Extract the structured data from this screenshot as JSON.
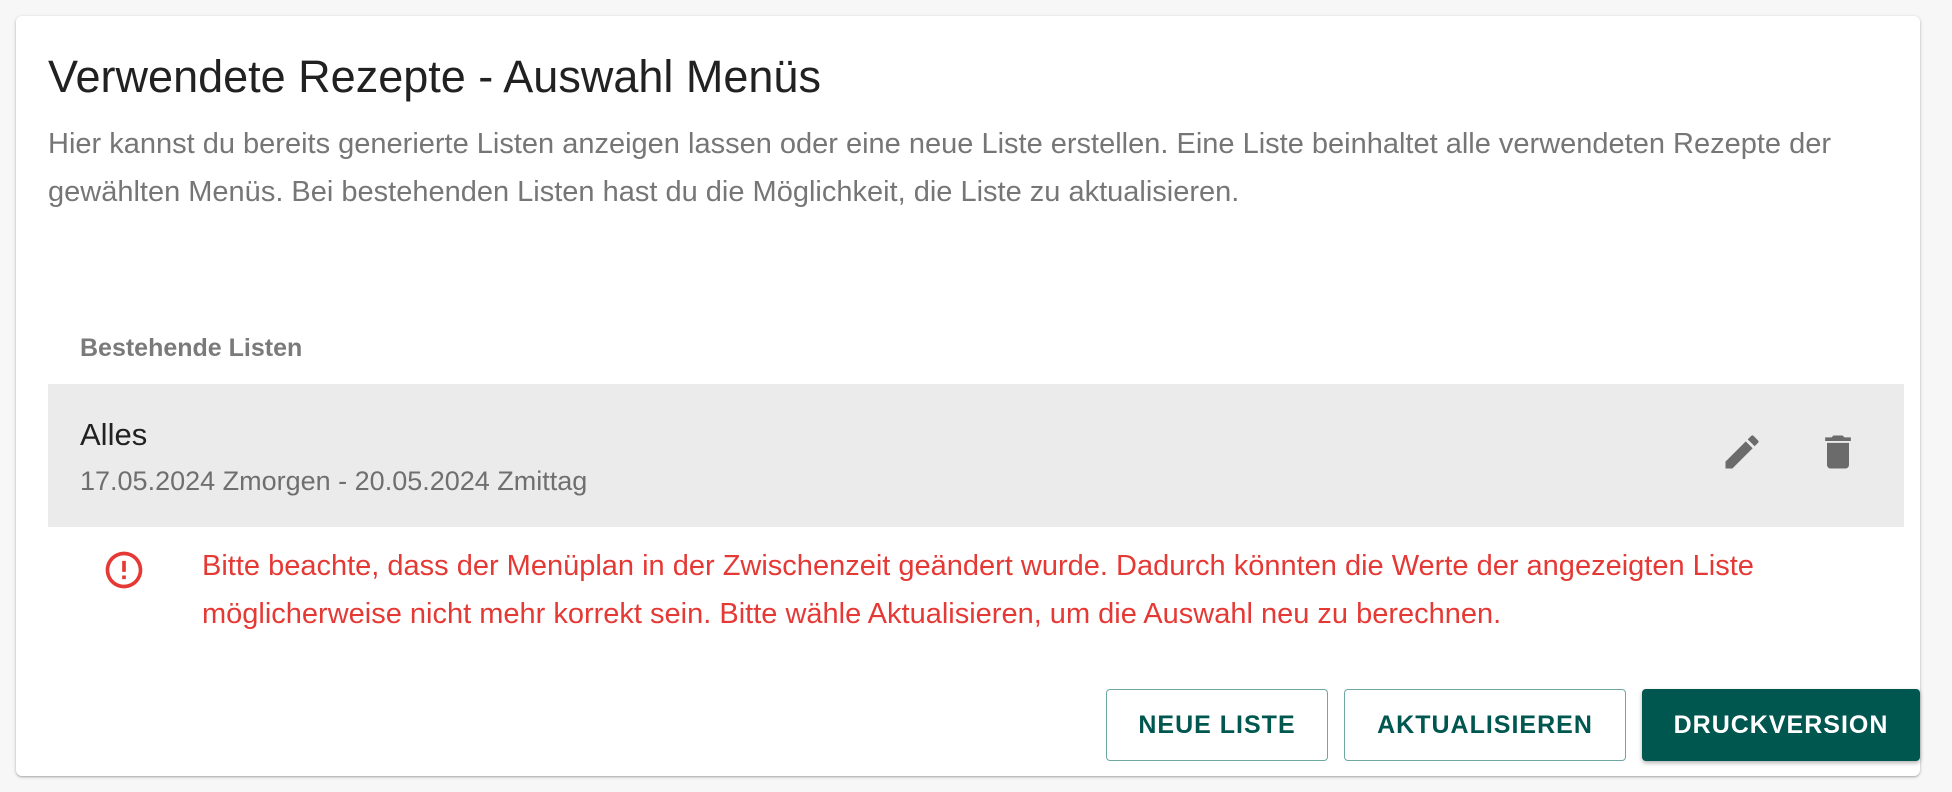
{
  "header": {
    "title": "Verwendete Rezepte - Auswahl Menüs",
    "description": "Hier kannst du bereits generierte Listen anzeigen lassen oder eine neue Liste erstellen. Eine Liste beinhaltet alle verwendeten Rezepte der gewählten Menüs. Bei bestehenden Listen hast du die Möglichkeit, die Liste zu aktualisieren."
  },
  "list": {
    "subheader": "Bestehende Listen",
    "items": [
      {
        "title": "Alles",
        "subtitle": "17.05.2024 Zmorgen - 20.05.2024 Zmittag",
        "actions": [
          "edit-icon",
          "delete-icon"
        ]
      }
    ]
  },
  "warning": {
    "icon": "error-outline-icon",
    "text": "Bitte beachte, dass der Menüplan in der Zwischenzeit geändert wurde. Dadurch könnten die Werte der angezeigten Liste möglicherweise nicht mehr korrekt sein. Bitte wähle Aktualisieren, um die Auswahl neu zu berechnen."
  },
  "actions": {
    "new_list": "Neue Liste",
    "update": "Aktualisieren",
    "print_version": "Druckversion"
  },
  "colors": {
    "primary": "#00574f",
    "error": "#e53935",
    "list_item_background": "#ebebeb",
    "icon": "#6b6b6b"
  }
}
